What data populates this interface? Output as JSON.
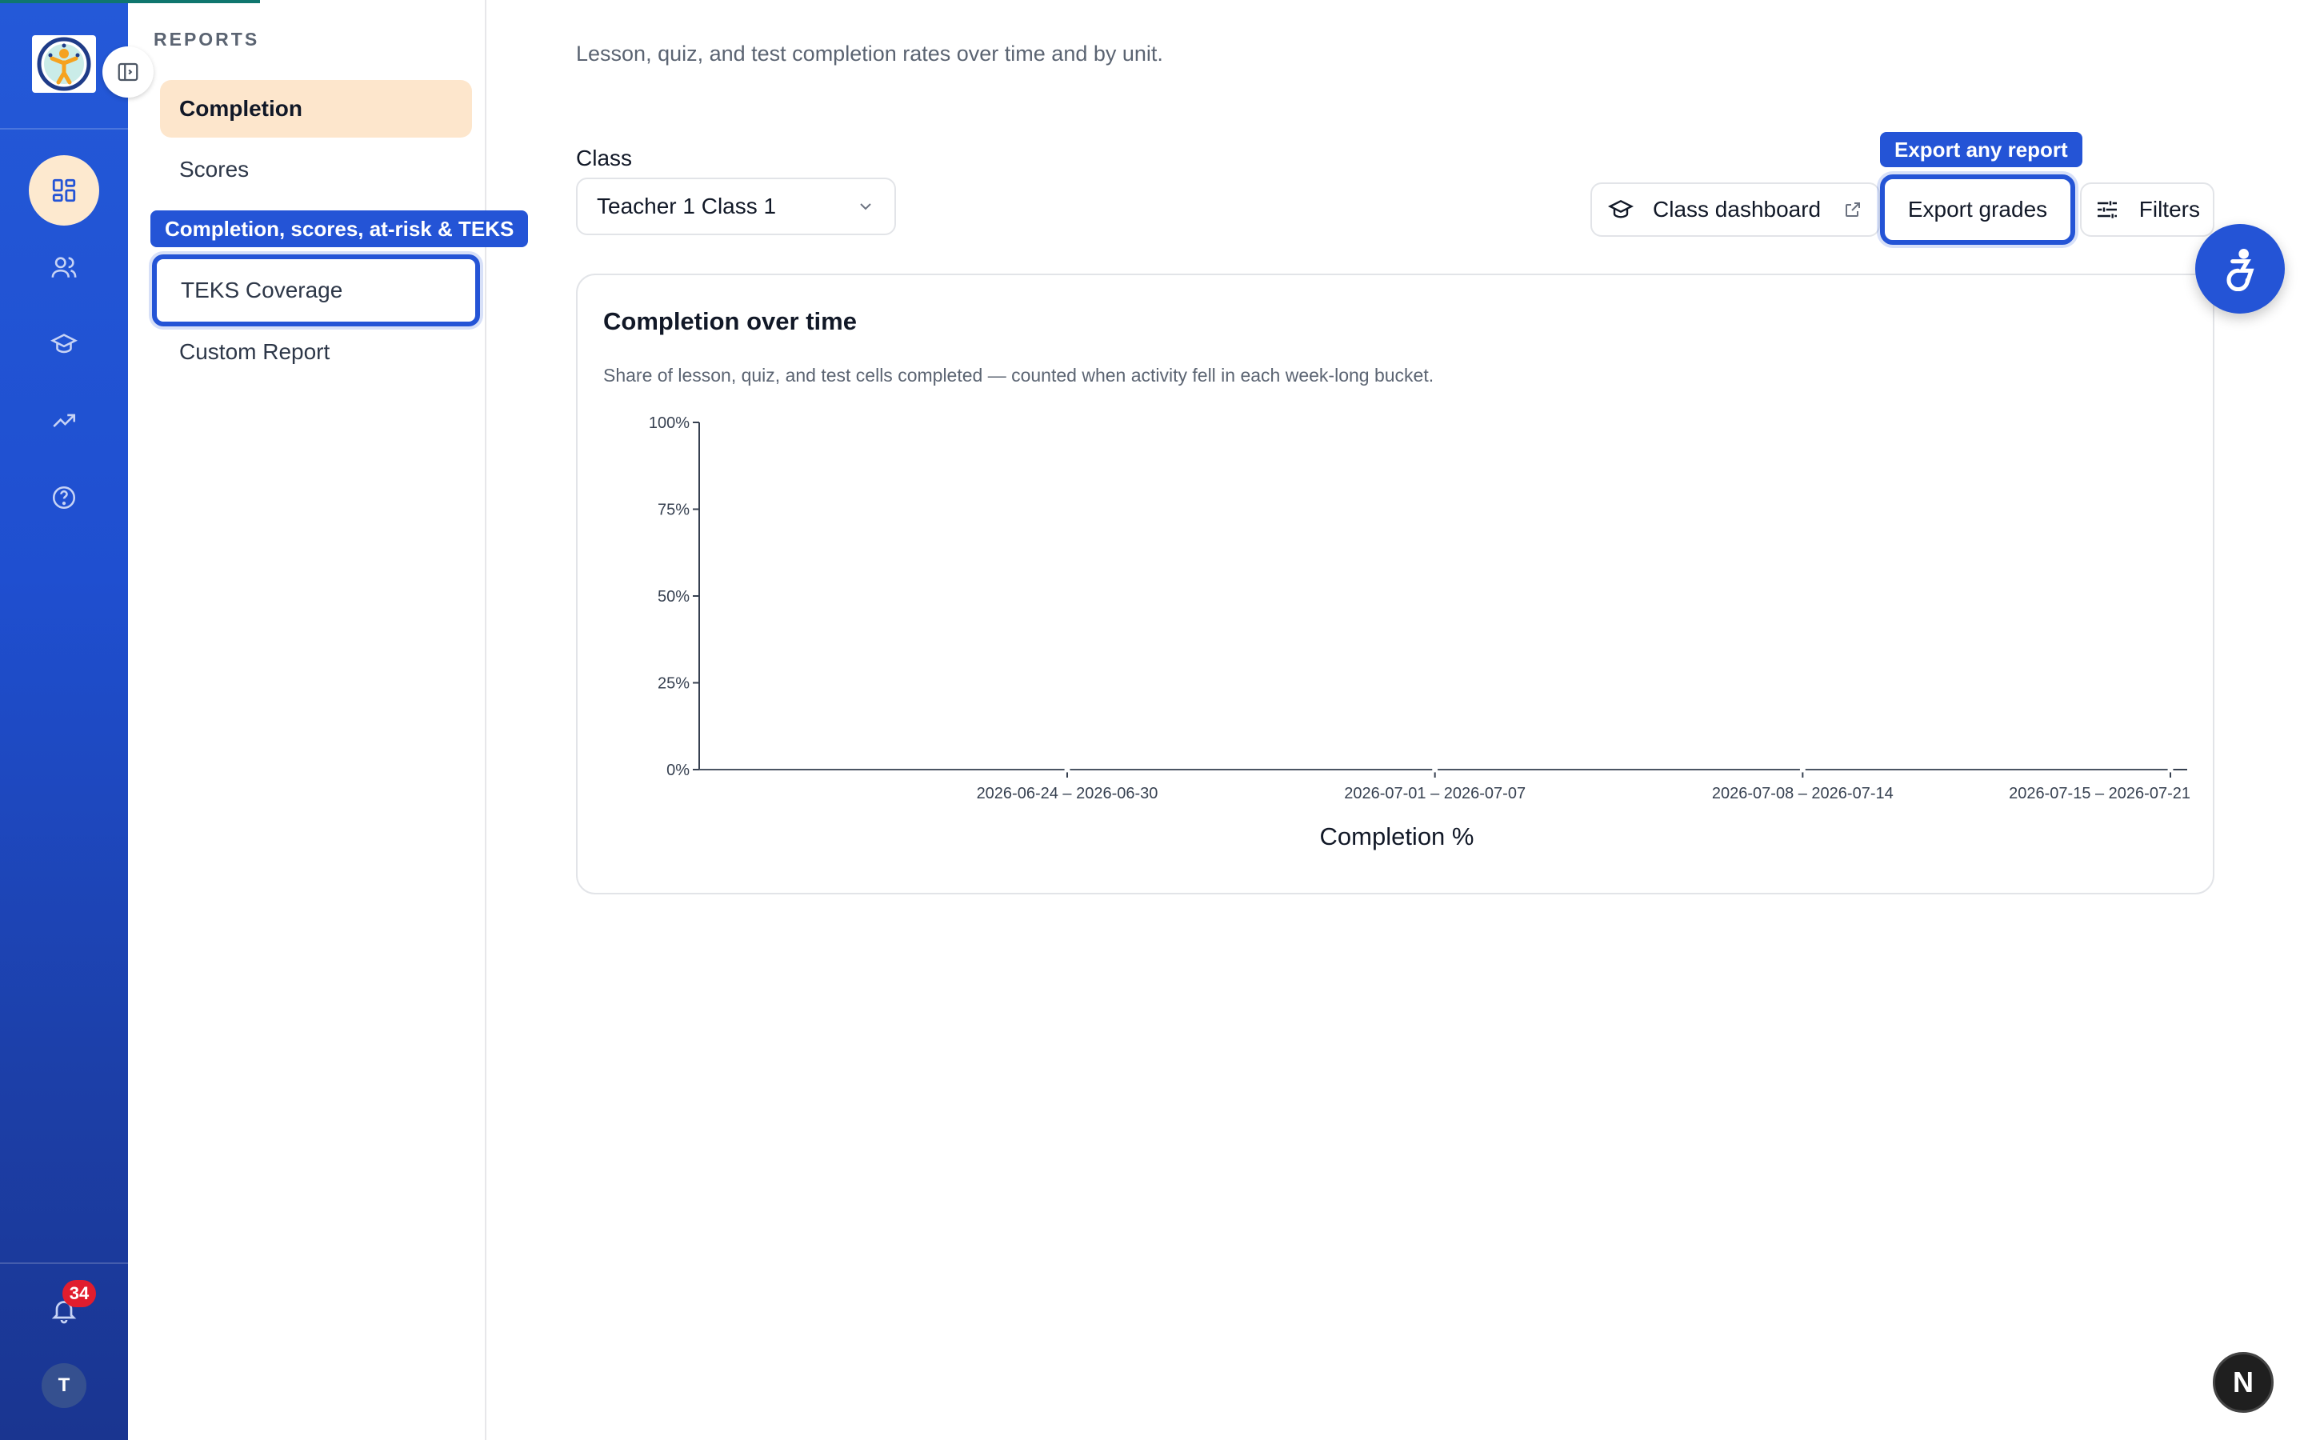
{
  "rail": {
    "icons": [
      "dashboard-icon",
      "users-icon",
      "graduation-cap-icon",
      "trending-up-icon",
      "help-circle-icon"
    ],
    "notification_count": "34",
    "avatar_initial": "T",
    "brand_color": "#2459d8",
    "active_color": "#fde9cf"
  },
  "panel": {
    "heading": "REPORTS",
    "items": [
      {
        "label": "Completion",
        "active": true
      },
      {
        "label": "Scores"
      },
      {
        "label": "TEKS Coverage",
        "highlighted": true
      },
      {
        "label": "Custom Report"
      }
    ],
    "tooltip": "Completion, scores, at-risk & TEKS"
  },
  "main": {
    "description": "Lesson, quiz, and test completion rates over time and by unit.",
    "class_label": "Class",
    "class_value": "Teacher 1 Class 1",
    "buttons": {
      "class_dashboard": "Class dashboard",
      "export": "Export grades",
      "export_tooltip": "Export any report",
      "filters": "Filters"
    }
  },
  "chart_data": {
    "type": "line",
    "title": "Completion over time",
    "subtitle": "Share of lesson, quiz, and test cells completed — counted when activity fell in each week-long bucket.",
    "xlabel": "Completion %",
    "ylabel": "",
    "categories": [
      "2026-06-24 – 2026-06-30",
      "2026-07-01 – 2026-07-07",
      "2026-07-08 – 2026-07-14",
      "2026-07-15 – 2026-07-21"
    ],
    "yticks": [
      "0%",
      "25%",
      "50%",
      "75%",
      "100%"
    ],
    "ylim": [
      0,
      100
    ],
    "series": [
      {
        "values": [
          0,
          0,
          0,
          0
        ]
      }
    ],
    "grid": false,
    "line_color": "#4b5563"
  },
  "dev_badge": "N"
}
